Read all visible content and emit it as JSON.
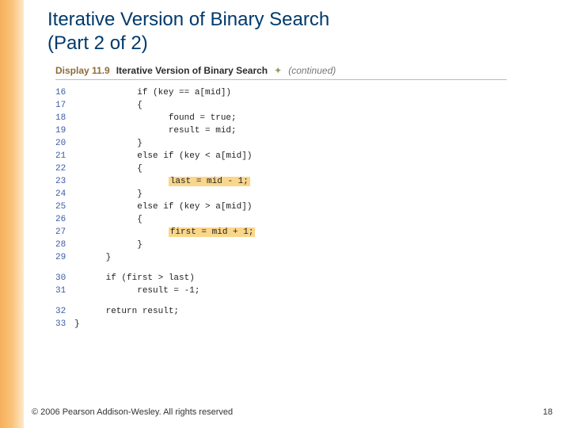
{
  "title_line1": "Iterative Version of Binary Search",
  "title_line2": "(Part 2 of 2)",
  "display": {
    "label": "Display 11.9",
    "title": "Iterative Version of Binary Search",
    "diamond": "✦",
    "continued": "(continued)"
  },
  "code": {
    "l16_num": "16",
    "l16_txt": "            if (key == a[mid])",
    "l17_num": "17",
    "l17_txt": "            {",
    "l18_num": "18",
    "l18_txt": "                  found = true;",
    "l19_num": "19",
    "l19_txt": "                  result = mid;",
    "l20_num": "20",
    "l20_txt": "            }",
    "l21_num": "21",
    "l21_txt": "            else if (key < a[mid])",
    "l22_num": "22",
    "l22_txt": "            {",
    "l23_num": "23",
    "l23_pre": "                  ",
    "l23_hl": "last = mid - 1;",
    "l24_num": "24",
    "l24_txt": "            }",
    "l25_num": "25",
    "l25_txt": "            else if (key > a[mid])",
    "l26_num": "26",
    "l26_txt": "            {",
    "l27_num": "27",
    "l27_pre": "                  ",
    "l27_hl": "first = mid + 1;",
    "l28_num": "28",
    "l28_txt": "            }",
    "l29_num": "29",
    "l29_txt": "      }",
    "l30_num": "30",
    "l30_txt": "      if (first > last)",
    "l31_num": "31",
    "l31_txt": "            result = -1;",
    "l32_num": "32",
    "l32_txt": "      return result;",
    "l33_num": "33",
    "l33_txt": "}"
  },
  "footer": "© 2006 Pearson Addison-Wesley. All rights reserved",
  "page_number": "18"
}
